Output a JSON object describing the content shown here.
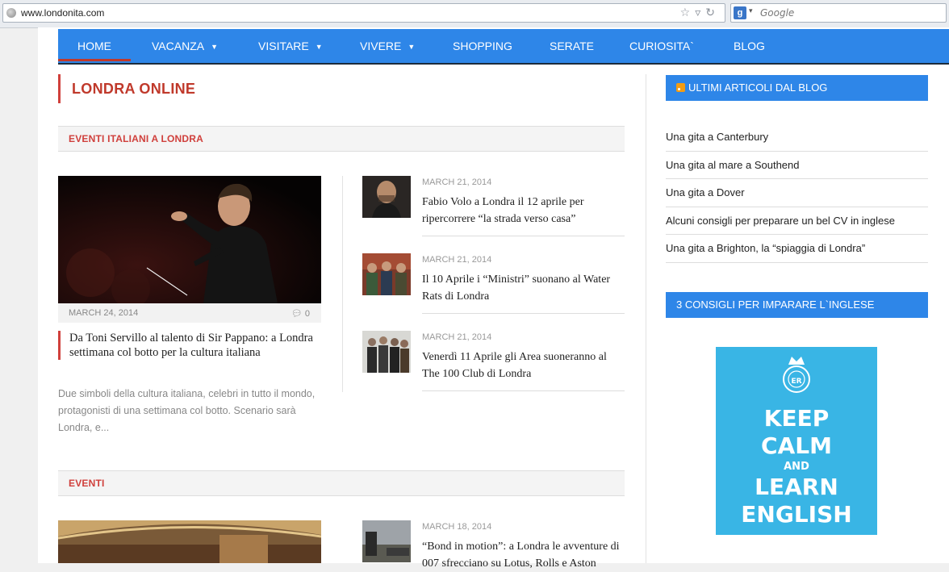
{
  "browser": {
    "url": "www.londonita.com",
    "search_placeholder": "Google",
    "google_letter": "g"
  },
  "nav": {
    "items": [
      {
        "label": "HOME",
        "active": true
      },
      {
        "label": "VACANZA",
        "dropdown": true
      },
      {
        "label": "VISITARE",
        "dropdown": true
      },
      {
        "label": "VIVERE",
        "dropdown": true
      },
      {
        "label": "SHOPPING"
      },
      {
        "label": "SERATE"
      },
      {
        "label": "CURIOSITA`"
      },
      {
        "label": "BLOG"
      }
    ]
  },
  "main": {
    "title": "LONDRA ONLINE",
    "section1": {
      "title": "EVENTI ITALIANI A LONDRA",
      "featured": {
        "date": "MARCH 24, 2014",
        "comments": "0",
        "title": "Da Toni Servillo al talento di Sir Pappano: a Londra settimana col botto per la cultura italiana",
        "excerpt": "Due simboli della cultura italiana, celebri in tutto il mondo, protagonisti di una settimana col botto. Scenario sarà Londra, e..."
      },
      "items": [
        {
          "date": "MARCH 21, 2014",
          "title": "Fabio Volo a Londra il 12 aprile per ripercorrere “la strada verso casa”"
        },
        {
          "date": "MARCH 21, 2014",
          "title": "Il 10 Aprile i “Ministri” suonano al Water Rats di Londra"
        },
        {
          "date": "MARCH 21, 2014",
          "title": "Venerdì 11 Aprile gli Area suoneranno al The 100 Club di Londra"
        }
      ]
    },
    "section2": {
      "title": "EVENTI",
      "items": [
        {
          "date": "MARCH 18, 2014",
          "title": "“Bond in motion”: a Londra le avventure di 007 sfrecciano su Lotus, Rolls e Aston"
        }
      ]
    }
  },
  "sidebar": {
    "widget1": {
      "title": "ULTIMI ARTICOLI DAL BLOG",
      "links": [
        "Una gita a Canterbury",
        "Una gita al mare a Southend",
        "Una gita a Dover",
        "Alcuni consigli per preparare un bel CV in inglese",
        "Una gita a Brighton, la “spiaggia di Londra”"
      ]
    },
    "widget2": {
      "title": "3 CONSIGLI PER IMPARARE L`INGLESE",
      "poster": {
        "line1": "KEEP",
        "line2": "CALM",
        "line3": "AND",
        "line4": "LEARN",
        "line5": "ENGLISH",
        "crest": "ER"
      }
    }
  }
}
